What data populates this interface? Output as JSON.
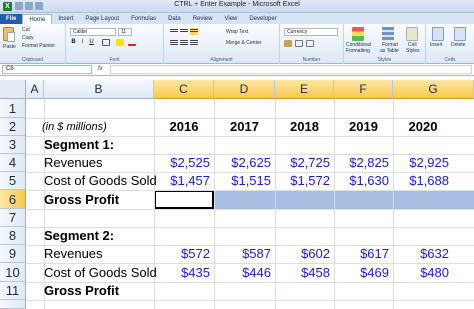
{
  "window": {
    "title": "CTRL + Enter Example  -  Microsoft Excel"
  },
  "ribbon_tabs": [
    {
      "label": "File"
    },
    {
      "label": "Home"
    },
    {
      "label": "Insert"
    },
    {
      "label": "Page Layout"
    },
    {
      "label": "Formulas"
    },
    {
      "label": "Data"
    },
    {
      "label": "Review"
    },
    {
      "label": "View"
    },
    {
      "label": "Developer"
    }
  ],
  "active_tab": "Home",
  "clipboard": {
    "paste": "Paste",
    "cut": "Cut",
    "copy": "Copy",
    "format_painter": "Format Painter",
    "group": "Clipboard"
  },
  "font": {
    "name": "Calibri",
    "size": "11",
    "group": "Font",
    "bold": "B",
    "italic": "I",
    "underline": "U"
  },
  "alignment": {
    "wrap": "Wrap Text",
    "merge": "Merge & Center",
    "group": "Alignment"
  },
  "number": {
    "format": "Currency",
    "group": "Number"
  },
  "styles": {
    "conditional": "Conditional",
    "conditional2": "Formatting",
    "format_table": "Format",
    "format_table2": "as Table",
    "cell_styles": "Cell",
    "cell_styles2": "Styles",
    "group": "Styles"
  },
  "cells": {
    "insert": "Insert",
    "delete": "Delete",
    "group": "Cells"
  },
  "formula_bar": {
    "name_box": "C6",
    "fx": "fx",
    "formula": ""
  },
  "columns": [
    "A",
    "B",
    "C",
    "D",
    "E",
    "F",
    "G"
  ],
  "rows": [
    "1",
    "2",
    "3",
    "4",
    "5",
    "6",
    "7",
    "8",
    "9",
    "10",
    "11"
  ],
  "sheet": {
    "r2": {
      "label": "(in $ millions)",
      "years": [
        "2016",
        "2017",
        "2018",
        "2019",
        "2020"
      ]
    },
    "r3": {
      "label": "Segment 1:"
    },
    "r4": {
      "label": "Revenues",
      "values": [
        "$2,525",
        "$2,625",
        "$2,725",
        "$2,825",
        "$2,925"
      ]
    },
    "r5": {
      "label": "Cost of Goods Sold",
      "values": [
        "$1,457",
        "$1,515",
        "$1,572",
        "$1,630",
        "$1,688"
      ]
    },
    "r6": {
      "label": "Gross Profit"
    },
    "r8": {
      "label": "Segment 2:"
    },
    "r9": {
      "label": "Revenues",
      "values": [
        "$572",
        "$587",
        "$602",
        "$617",
        "$632"
      ]
    },
    "r10": {
      "label": "Cost of Goods Sold",
      "values": [
        "$435",
        "$446",
        "$458",
        "$469",
        "$480"
      ]
    },
    "r11": {
      "label": "Gross Profit"
    }
  },
  "colors": {
    "selection": "#a9bee3",
    "header_selected": "#f7c94d",
    "number_text": "#1a1ae6",
    "file_tab": "#1f5fae"
  }
}
